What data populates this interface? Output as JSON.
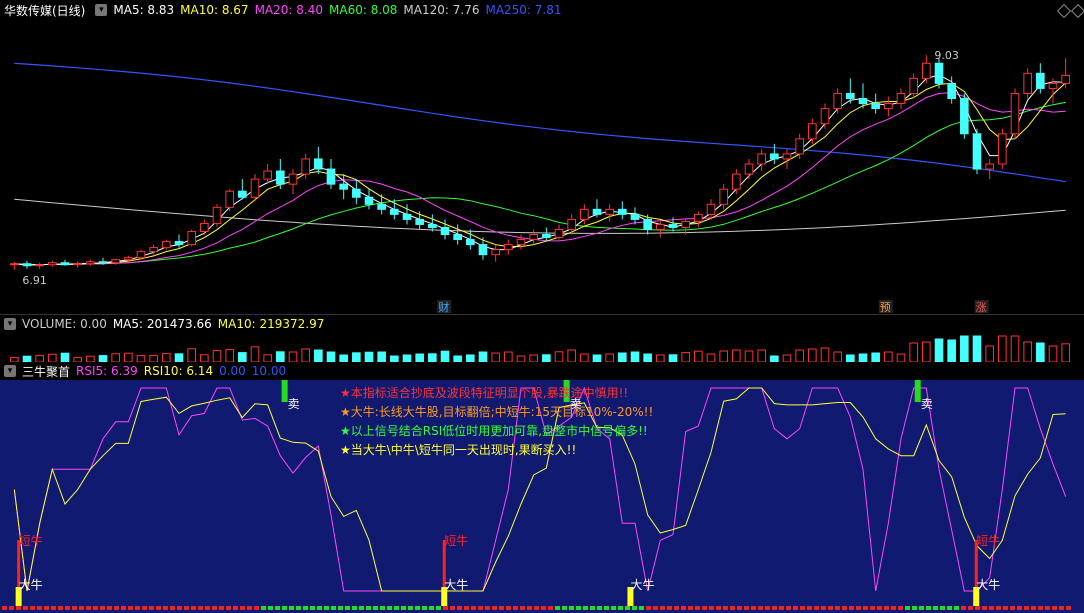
{
  "main": {
    "title": "华数传媒(日线)",
    "ma": [
      {
        "label": "MA5: 8.83",
        "color": "#ffffff"
      },
      {
        "label": "MA10: 8.67",
        "color": "#ffff33"
      },
      {
        "label": "MA20: 8.40",
        "color": "#ff44ff"
      },
      {
        "label": "MA60: 8.08",
        "color": "#33ff33"
      },
      {
        "label": "MA120: 7.76",
        "color": "#cccccc"
      },
      {
        "label": "MA250: 7.81",
        "color": "#3355ff"
      }
    ],
    "high_label": "9.03",
    "low_label": "6.91",
    "markers": [
      {
        "text": "财",
        "color": "#44aaff"
      },
      {
        "text": "预",
        "color": "#ff9933"
      },
      {
        "text": "涨",
        "color": "#ff5555"
      }
    ],
    "ylim": [
      6.6,
      9.3
    ]
  },
  "volume": {
    "title": "VOLUME: 0.00",
    "ma5": "MA5: 201473.66",
    "ma10": "MA10: 219372.97"
  },
  "indicator": {
    "title": "三牛聚首",
    "rsi5": "RSI5: 6.39",
    "rsi10": "RSI10: 6.14",
    "v1": "0.00",
    "v2": "10.00",
    "notes": [
      {
        "text": "★本指标适合抄底及波段特征明显个股,暴跌途中慎用!!",
        "color": "#ff3333"
      },
      {
        "text": "★大牛:长线大牛股,目标翻倍;中短牛:15天目标10%-20%!!",
        "color": "#ff9922"
      },
      {
        "text": "★以上信号结合RSI低位时用更加可靠,盘整市中信号偏多!!",
        "color": "#33ff33"
      },
      {
        "text": "★当大牛\\中牛\\短牛同一天出现时,果断买入!!",
        "color": "#ffff33"
      }
    ],
    "sell_label": "卖",
    "short_label": "短牛",
    "big_label": "大牛"
  },
  "chart_data": {
    "type": "line",
    "candles": [
      [
        6.95,
        6.98,
        6.9,
        6.96
      ],
      [
        6.96,
        6.99,
        6.91,
        6.94
      ],
      [
        6.94,
        6.97,
        6.91,
        6.95
      ],
      [
        6.95,
        6.99,
        6.93,
        6.97
      ],
      [
        6.97,
        7.0,
        6.94,
        6.95
      ],
      [
        6.95,
        6.98,
        6.92,
        6.96
      ],
      [
        6.96,
        7.0,
        6.94,
        6.98
      ],
      [
        6.98,
        7.02,
        6.95,
        6.97
      ],
      [
        6.97,
        7.01,
        6.95,
        7.0
      ],
      [
        7.0,
        7.04,
        6.97,
        7.02
      ],
      [
        7.02,
        7.1,
        7.0,
        7.08
      ],
      [
        7.08,
        7.15,
        7.05,
        7.12
      ],
      [
        7.12,
        7.2,
        7.1,
        7.18
      ],
      [
        7.18,
        7.25,
        7.12,
        7.15
      ],
      [
        7.15,
        7.3,
        7.13,
        7.28
      ],
      [
        7.28,
        7.4,
        7.25,
        7.36
      ],
      [
        7.36,
        7.55,
        7.33,
        7.52
      ],
      [
        7.52,
        7.7,
        7.48,
        7.68
      ],
      [
        7.68,
        7.8,
        7.6,
        7.62
      ],
      [
        7.62,
        7.85,
        7.58,
        7.8
      ],
      [
        7.8,
        7.95,
        7.75,
        7.88
      ],
      [
        7.88,
        8.0,
        7.7,
        7.75
      ],
      [
        7.75,
        7.9,
        7.65,
        7.85
      ],
      [
        7.85,
        8.05,
        7.8,
        8.0
      ],
      [
        8.0,
        8.12,
        7.85,
        7.9
      ],
      [
        7.9,
        8.0,
        7.7,
        7.75
      ],
      [
        7.75,
        7.85,
        7.6,
        7.7
      ],
      [
        7.7,
        7.8,
        7.55,
        7.62
      ],
      [
        7.62,
        7.7,
        7.5,
        7.55
      ],
      [
        7.55,
        7.65,
        7.45,
        7.5
      ],
      [
        7.5,
        7.6,
        7.4,
        7.45
      ],
      [
        7.45,
        7.55,
        7.35,
        7.4
      ],
      [
        7.4,
        7.48,
        7.3,
        7.35
      ],
      [
        7.35,
        7.45,
        7.28,
        7.32
      ],
      [
        7.32,
        7.4,
        7.2,
        7.25
      ],
      [
        7.25,
        7.35,
        7.15,
        7.2
      ],
      [
        7.2,
        7.3,
        7.1,
        7.15
      ],
      [
        7.15,
        7.22,
        7.0,
        7.05
      ],
      [
        7.05,
        7.15,
        6.98,
        7.1
      ],
      [
        7.1,
        7.2,
        7.05,
        7.15
      ],
      [
        7.15,
        7.25,
        7.1,
        7.2
      ],
      [
        7.2,
        7.3,
        7.15,
        7.25
      ],
      [
        7.25,
        7.32,
        7.18,
        7.22
      ],
      [
        7.22,
        7.35,
        7.2,
        7.3
      ],
      [
        7.3,
        7.45,
        7.25,
        7.4
      ],
      [
        7.4,
        7.55,
        7.35,
        7.5
      ],
      [
        7.5,
        7.6,
        7.42,
        7.45
      ],
      [
        7.45,
        7.55,
        7.38,
        7.5
      ],
      [
        7.5,
        7.58,
        7.4,
        7.45
      ],
      [
        7.45,
        7.52,
        7.35,
        7.4
      ],
      [
        7.4,
        7.45,
        7.25,
        7.3
      ],
      [
        7.3,
        7.38,
        7.22,
        7.35
      ],
      [
        7.35,
        7.42,
        7.28,
        7.32
      ],
      [
        7.32,
        7.4,
        7.25,
        7.38
      ],
      [
        7.38,
        7.48,
        7.32,
        7.45
      ],
      [
        7.45,
        7.6,
        7.4,
        7.55
      ],
      [
        7.55,
        7.75,
        7.5,
        7.7
      ],
      [
        7.7,
        7.9,
        7.65,
        7.85
      ],
      [
        7.85,
        8.0,
        7.8,
        7.95
      ],
      [
        7.95,
        8.1,
        7.88,
        8.05
      ],
      [
        8.05,
        8.15,
        7.95,
        8.0
      ],
      [
        8.0,
        8.1,
        7.9,
        8.05
      ],
      [
        8.05,
        8.25,
        8.0,
        8.2
      ],
      [
        8.2,
        8.4,
        8.15,
        8.35
      ],
      [
        8.35,
        8.55,
        8.3,
        8.5
      ],
      [
        8.5,
        8.7,
        8.45,
        8.65
      ],
      [
        8.65,
        8.8,
        8.55,
        8.6
      ],
      [
        8.6,
        8.75,
        8.5,
        8.55
      ],
      [
        8.55,
        8.65,
        8.45,
        8.5
      ],
      [
        8.5,
        8.62,
        8.42,
        8.55
      ],
      [
        8.55,
        8.7,
        8.5,
        8.65
      ],
      [
        8.65,
        8.85,
        8.6,
        8.8
      ],
      [
        8.8,
        9.03,
        8.75,
        8.95
      ],
      [
        8.95,
        9.0,
        8.7,
        8.75
      ],
      [
        8.75,
        8.82,
        8.55,
        8.6
      ],
      [
        8.6,
        8.65,
        8.2,
        8.25
      ],
      [
        8.25,
        8.3,
        7.85,
        7.9
      ],
      [
        7.9,
        8.0,
        7.8,
        7.95
      ],
      [
        7.95,
        8.3,
        7.9,
        8.25
      ],
      [
        8.25,
        8.7,
        8.2,
        8.65
      ],
      [
        8.65,
        8.9,
        8.6,
        8.85
      ],
      [
        8.85,
        8.95,
        8.65,
        8.7
      ],
      [
        8.7,
        8.8,
        8.55,
        8.75
      ],
      [
        8.75,
        9.0,
        8.7,
        8.83
      ]
    ]
  }
}
